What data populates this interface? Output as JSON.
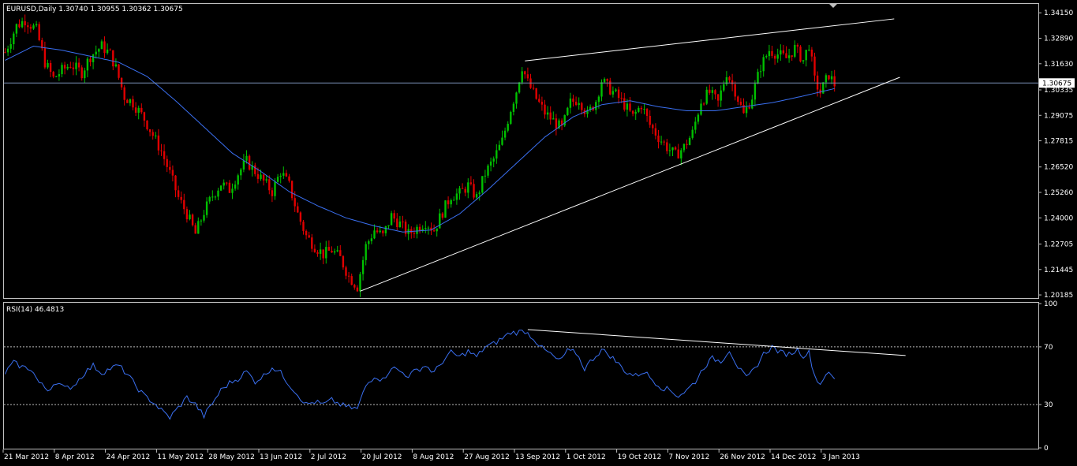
{
  "chart_data": [
    {
      "type": "candlestick",
      "header": "EURUSD,Daily  1.30740 1.30955 1.30362 1.30675",
      "current_price": 1.30675,
      "current_price_label": "1.30675",
      "y_ticks": [
        1.20185,
        1.21445,
        1.22705,
        1.24,
        1.2526,
        1.2652,
        1.27815,
        1.29075,
        1.30335,
        1.3163,
        1.3289,
        1.3415
      ],
      "y_tick_labels": [
        "1.20185",
        "1.21445",
        "1.22705",
        "1.24000",
        "1.25260",
        "1.26520",
        "1.27815",
        "1.29075",
        "1.30335",
        "1.31630",
        "1.32890",
        "1.34150"
      ],
      "ylim": [
        1.2007,
        1.3455
      ],
      "x_labels": [
        "21 Mar 2012",
        "8 Apr 2012",
        "24 Apr 2012",
        "11 May 2012",
        "28 May 2012",
        "13 Jun 2012",
        "2 Jul 2012",
        "20 Jul 2012",
        "8 Aug 2012",
        "27 Aug 2012",
        "13 Sep 2012",
        "1 Oct 2012",
        "19 Oct 2012",
        "7 Nov 2012",
        "26 Nov 2012",
        "14 Dec 2012",
        "3 Jan 2013"
      ],
      "bar_count": 248,
      "price_path": [
        [
          0,
          1.322
        ],
        [
          4,
          1.335
        ],
        [
          7,
          1.338
        ],
        [
          11,
          1.333
        ],
        [
          14,
          1.317
        ],
        [
          17,
          1.309
        ],
        [
          20,
          1.313
        ],
        [
          23,
          1.316
        ],
        [
          27,
          1.312
        ],
        [
          30,
          1.32
        ],
        [
          34,
          1.325
        ],
        [
          37,
          1.321
        ],
        [
          39,
          1.314
        ],
        [
          42,
          1.3
        ],
        [
          45,
          1.297
        ],
        [
          49,
          1.289
        ],
        [
          52,
          1.281
        ],
        [
          55,
          1.273
        ],
        [
          58,
          1.262
        ],
        [
          61,
          1.25
        ],
        [
          64,
          1.242
        ],
        [
          67,
          1.232
        ],
        [
          70,
          1.243
        ],
        [
          73,
          1.251
        ],
        [
          76,
          1.257
        ],
        [
          79,
          1.254
        ],
        [
          82,
          1.262
        ],
        [
          85,
          1.268
        ],
        [
          88,
          1.263
        ],
        [
          91,
          1.258
        ],
        [
          94,
          1.253
        ],
        [
          97,
          1.263
        ],
        [
          100,
          1.256
        ],
        [
          103,
          1.242
        ],
        [
          106,
          1.231
        ],
        [
          109,
          1.226
        ],
        [
          112,
          1.222
        ],
        [
          115,
          1.224
        ],
        [
          118,
          1.22
        ],
        [
          121,
          1.211
        ],
        [
          124,
          1.206
        ],
        [
          127,
          1.226
        ],
        [
          130,
          1.234
        ],
        [
          133,
          1.231
        ],
        [
          136,
          1.241
        ],
        [
          139,
          1.237
        ],
        [
          142,
          1.232
        ],
        [
          145,
          1.235
        ],
        [
          148,
          1.238
        ],
        [
          151,
          1.234
        ],
        [
          154,
          1.243
        ],
        [
          157,
          1.251
        ],
        [
          160,
          1.252
        ],
        [
          163,
          1.256
        ],
        [
          166,
          1.25
        ],
        [
          169,
          1.262
        ],
        [
          172,
          1.269
        ],
        [
          175,
          1.278
        ],
        [
          178,
          1.294
        ],
        [
          180,
          1.303
        ],
        [
          182,
          1.315
        ],
        [
          184,
          1.307
        ],
        [
          187,
          1.299
        ],
        [
          190,
          1.292
        ],
        [
          193,
          1.288
        ],
        [
          196,
          1.284
        ],
        [
          199,
          1.297
        ],
        [
          202,
          1.299
        ],
        [
          205,
          1.291
        ],
        [
          208,
          1.298
        ],
        [
          210,
          1.308
        ],
        [
          212,
          1.305
        ],
        [
          215,
          1.301
        ],
        [
          218,
          1.296
        ],
        [
          221,
          1.29
        ],
        [
          224,
          1.296
        ],
        [
          227,
          1.286
        ],
        [
          230,
          1.28
        ],
        [
          233,
          1.275
        ],
        [
          236,
          1.271
        ],
        [
          239,
          1.275
        ],
        [
          242,
          1.282
        ],
        [
          245,
          1.298
        ],
        [
          248,
          1.302
        ],
        [
          251,
          1.297
        ],
        [
          254,
          1.312
        ],
        [
          257,
          1.303
        ],
        [
          260,
          1.291
        ],
        [
          263,
          1.3
        ],
        [
          266,
          1.315
        ],
        [
          269,
          1.323
        ],
        [
          272,
          1.321
        ],
        [
          275,
          1.319
        ],
        [
          278,
          1.324
        ],
        [
          281,
          1.318
        ],
        [
          283,
          1.326
        ],
        [
          285,
          1.308
        ],
        [
          287,
          1.302
        ],
        [
          290,
          1.311
        ],
        [
          292,
          1.306
        ]
      ],
      "ma_path": [
        [
          0,
          1.318
        ],
        [
          10,
          1.325
        ],
        [
          20,
          1.323
        ],
        [
          30,
          1.32
        ],
        [
          40,
          1.317
        ],
        [
          50,
          1.31
        ],
        [
          60,
          1.298
        ],
        [
          70,
          1.285
        ],
        [
          80,
          1.272
        ],
        [
          90,
          1.263
        ],
        [
          100,
          1.253
        ],
        [
          110,
          1.246
        ],
        [
          120,
          1.24
        ],
        [
          130,
          1.236
        ],
        [
          140,
          1.233
        ],
        [
          150,
          1.234
        ],
        [
          160,
          1.242
        ],
        [
          170,
          1.254
        ],
        [
          180,
          1.267
        ],
        [
          190,
          1.28
        ],
        [
          200,
          1.29
        ],
        [
          210,
          1.296
        ],
        [
          220,
          1.298
        ],
        [
          230,
          1.295
        ],
        [
          240,
          1.293
        ],
        [
          250,
          1.293
        ],
        [
          260,
          1.295
        ],
        [
          270,
          1.297
        ],
        [
          280,
          1.3
        ],
        [
          292,
          1.304
        ]
      ],
      "trendlines": [
        {
          "from": [
            125,
            1.2037
          ],
          "to": [
            315,
            1.3096
          ]
        },
        {
          "from": [
            183,
            1.3177
          ],
          "to": [
            313,
            1.3385
          ]
        }
      ]
    },
    {
      "type": "line",
      "header": "RSI(14) 46.4813",
      "ylim": [
        0,
        100
      ],
      "y_ticks": [
        0,
        30,
        70,
        100
      ],
      "y_tick_labels": [
        "0",
        "30",
        "70",
        "100"
      ],
      "levels": [
        30,
        70
      ],
      "rsi_path": [
        [
          0,
          52
        ],
        [
          3,
          59
        ],
        [
          6,
          56
        ],
        [
          9,
          55
        ],
        [
          12,
          45
        ],
        [
          15,
          40
        ],
        [
          18,
          46
        ],
        [
          21,
          41
        ],
        [
          24,
          43
        ],
        [
          28,
          52
        ],
        [
          31,
          57
        ],
        [
          34,
          52
        ],
        [
          37,
          55
        ],
        [
          40,
          57
        ],
        [
          43,
          51
        ],
        [
          46,
          43
        ],
        [
          49,
          36
        ],
        [
          52,
          32
        ],
        [
          55,
          26
        ],
        [
          58,
          21
        ],
        [
          61,
          28
        ],
        [
          64,
          35
        ],
        [
          67,
          30
        ],
        [
          70,
          22
        ],
        [
          73,
          31
        ],
        [
          76,
          40
        ],
        [
          79,
          45
        ],
        [
          82,
          48
        ],
        [
          85,
          53
        ],
        [
          88,
          46
        ],
        [
          91,
          50
        ],
        [
          94,
          56
        ],
        [
          97,
          52
        ],
        [
          100,
          44
        ],
        [
          103,
          37
        ],
        [
          106,
          30
        ],
        [
          109,
          32
        ],
        [
          112,
          30
        ],
        [
          115,
          33
        ],
        [
          118,
          30
        ],
        [
          121,
          28
        ],
        [
          124,
          27
        ],
        [
          127,
          43
        ],
        [
          130,
          50
        ],
        [
          133,
          47
        ],
        [
          136,
          56
        ],
        [
          139,
          53
        ],
        [
          142,
          50
        ],
        [
          145,
          54
        ],
        [
          148,
          57
        ],
        [
          151,
          52
        ],
        [
          154,
          60
        ],
        [
          157,
          66
        ],
        [
          160,
          63
        ],
        [
          163,
          67
        ],
        [
          166,
          63
        ],
        [
          169,
          70
        ],
        [
          172,
          72
        ],
        [
          175,
          76
        ],
        [
          178,
          80
        ],
        [
          180,
          80
        ],
        [
          183,
          81
        ],
        [
          186,
          76
        ],
        [
          189,
          69
        ],
        [
          192,
          65
        ],
        [
          195,
          60
        ],
        [
          198,
          67
        ],
        [
          201,
          66
        ],
        [
          204,
          55
        ],
        [
          207,
          62
        ],
        [
          210,
          68
        ],
        [
          213,
          64
        ],
        [
          216,
          58
        ],
        [
          219,
          52
        ],
        [
          222,
          50
        ],
        [
          225,
          53
        ],
        [
          228,
          47
        ],
        [
          231,
          42
        ],
        [
          234,
          40
        ],
        [
          237,
          36
        ],
        [
          240,
          40
        ],
        [
          243,
          46
        ],
        [
          246,
          56
        ],
        [
          249,
          62
        ],
        [
          252,
          60
        ],
        [
          255,
          68
        ],
        [
          258,
          56
        ],
        [
          261,
          48
        ],
        [
          264,
          55
        ],
        [
          267,
          65
        ],
        [
          270,
          70
        ],
        [
          273,
          66
        ],
        [
          276,
          65
        ],
        [
          279,
          68
        ],
        [
          281,
          64
        ],
        [
          283,
          66
        ],
        [
          285,
          50
        ],
        [
          287,
          44
        ],
        [
          289,
          52
        ],
        [
          292,
          48
        ]
      ],
      "trendline": {
        "from": [
          184,
          82
        ],
        "to": [
          317,
          64
        ]
      }
    }
  ]
}
